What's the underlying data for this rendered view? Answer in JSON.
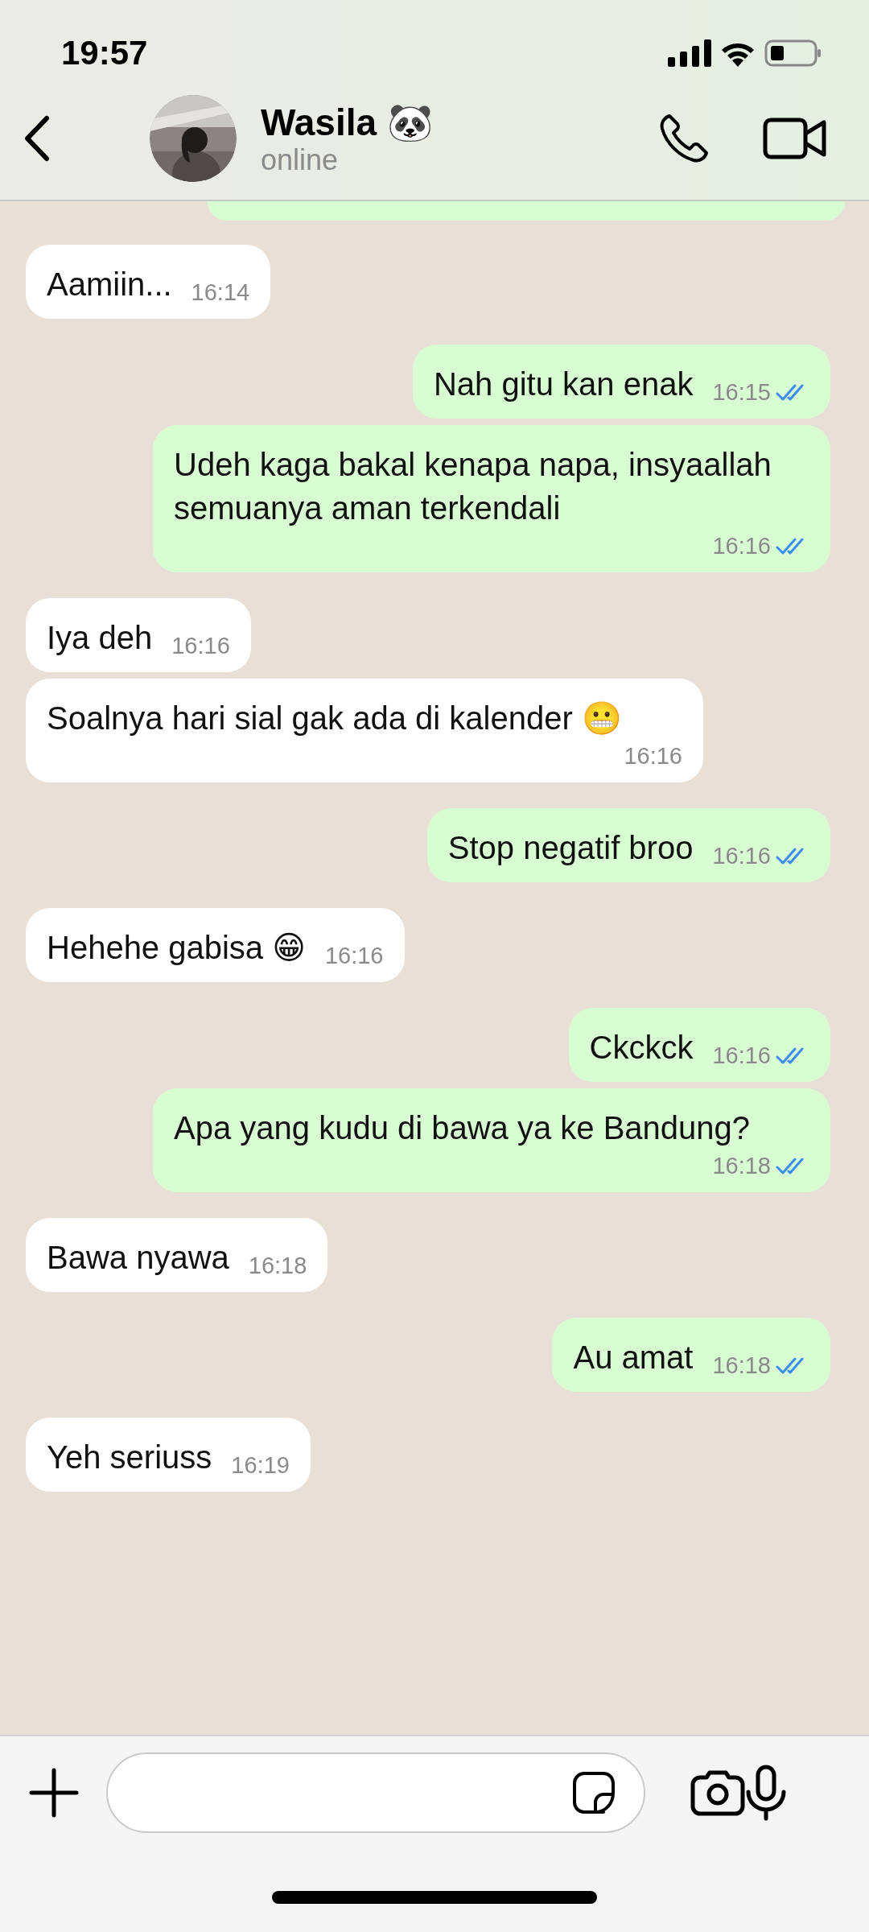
{
  "status_bar": {
    "time": "19:57"
  },
  "header": {
    "name": "Wasila 🐼",
    "status": "online"
  },
  "messages": [
    {
      "kind": "incoming",
      "text": "Aamiin...",
      "time": "16:14"
    },
    {
      "kind": "outgoing",
      "text": "Nah gitu kan enak",
      "time": "16:15",
      "read": true
    },
    {
      "kind": "outgoing",
      "text": "Udeh kaga bakal kenapa napa, insyaallah semuanya aman terkendali",
      "time": "16:16",
      "read": true
    },
    {
      "kind": "incoming",
      "text": "Iya deh",
      "time": "16:16"
    },
    {
      "kind": "incoming",
      "text": "Soalnya hari sial gak ada di kalender 😬",
      "time": "16:16"
    },
    {
      "kind": "outgoing",
      "text": "Stop negatif broo",
      "time": "16:16",
      "read": true
    },
    {
      "kind": "incoming",
      "text": "Hehehe gabisa 😁",
      "time": "16:16"
    },
    {
      "kind": "outgoing",
      "text": "Ckckck",
      "time": "16:16",
      "read": true
    },
    {
      "kind": "outgoing",
      "text": "Apa yang kudu di bawa ya ke Bandung?",
      "time": "16:18",
      "read": true
    },
    {
      "kind": "incoming",
      "text": "Bawa nyawa",
      "time": "16:18"
    },
    {
      "kind": "outgoing",
      "text": "Au amat",
      "time": "16:18",
      "read": true
    },
    {
      "kind": "incoming",
      "text": "Yeh seriuss",
      "time": "16:19"
    }
  ]
}
